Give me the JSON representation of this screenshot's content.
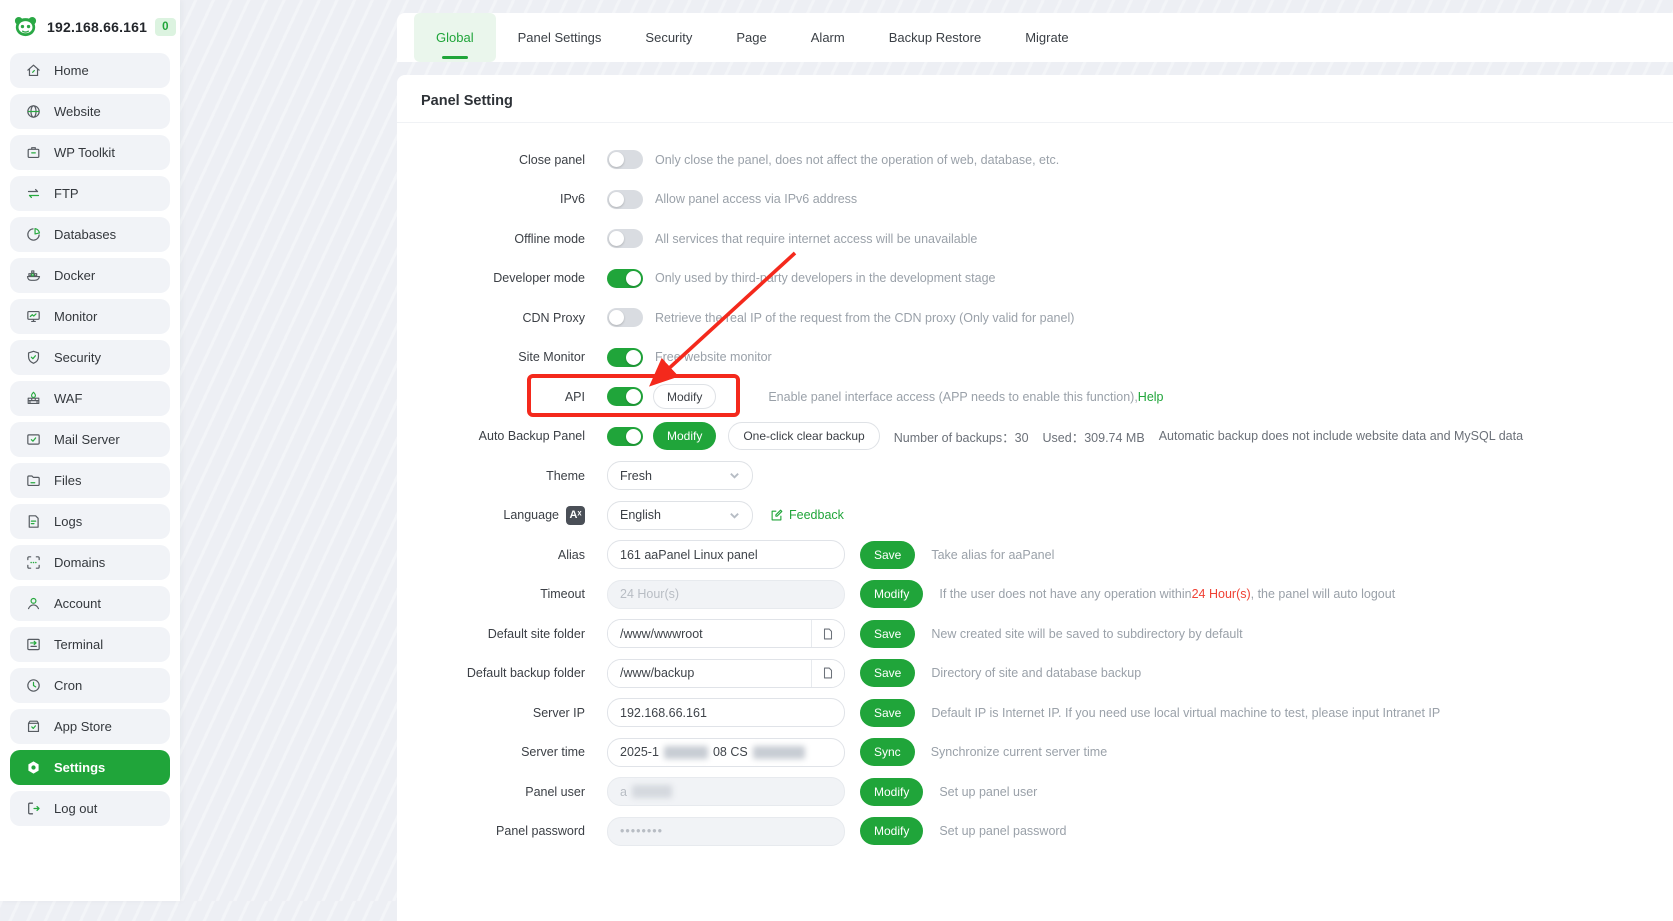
{
  "brand": {
    "ip": "192.168.66.161",
    "badge": "0"
  },
  "sidebar": {
    "items": [
      {
        "label": "Home",
        "icon": "home",
        "active": false
      },
      {
        "label": "Website",
        "icon": "website",
        "active": false
      },
      {
        "label": "WP Toolkit",
        "icon": "wp-toolkit",
        "active": false
      },
      {
        "label": "FTP",
        "icon": "ftp",
        "active": false
      },
      {
        "label": "Databases",
        "icon": "databases",
        "active": false
      },
      {
        "label": "Docker",
        "icon": "docker",
        "active": false
      },
      {
        "label": "Monitor",
        "icon": "monitor",
        "active": false
      },
      {
        "label": "Security",
        "icon": "security",
        "active": false
      },
      {
        "label": "WAF",
        "icon": "waf",
        "active": false
      },
      {
        "label": "Mail Server",
        "icon": "mail-server",
        "active": false
      },
      {
        "label": "Files",
        "icon": "files",
        "active": false
      },
      {
        "label": "Logs",
        "icon": "logs",
        "active": false
      },
      {
        "label": "Domains",
        "icon": "domains",
        "active": false
      },
      {
        "label": "Account",
        "icon": "account",
        "active": false
      },
      {
        "label": "Terminal",
        "icon": "terminal",
        "active": false
      },
      {
        "label": "Cron",
        "icon": "cron",
        "active": false
      },
      {
        "label": "App Store",
        "icon": "app-store",
        "active": false
      },
      {
        "label": "Settings",
        "icon": "settings",
        "active": true
      },
      {
        "label": "Log out",
        "icon": "logout",
        "active": false
      }
    ]
  },
  "tabs": [
    {
      "label": "Global",
      "active": true
    },
    {
      "label": "Panel Settings",
      "active": false
    },
    {
      "label": "Security",
      "active": false
    },
    {
      "label": "Page",
      "active": false
    },
    {
      "label": "Alarm",
      "active": false
    },
    {
      "label": "Backup Restore",
      "active": false
    },
    {
      "label": "Migrate",
      "active": false
    }
  ],
  "panel": {
    "title": "Panel Setting",
    "rows": {
      "close_panel": {
        "label": "Close panel",
        "desc": "Only close the panel, does not affect the operation of web, database, etc."
      },
      "ipv6": {
        "label": "IPv6",
        "desc": "Allow panel access via IPv6 address"
      },
      "offline_mode": {
        "label": "Offline mode",
        "desc": "All services that require internet access will be unavailable"
      },
      "developer_mode": {
        "label": "Developer mode",
        "desc": "Only used by third-party developers in the development stage"
      },
      "cdn_proxy": {
        "label": "CDN Proxy",
        "desc": "Retrieve the real IP of the request from the CDN proxy  (Only valid for panel)"
      },
      "site_monitor": {
        "label": "Site Monitor",
        "desc": "Free website monitor"
      },
      "api": {
        "label": "API",
        "modify": "Modify",
        "desc": "Enable panel interface access (APP needs to enable this function),",
        "help": "Help"
      },
      "auto_backup": {
        "label": "Auto Backup Panel",
        "modify": "Modify",
        "clear": "One-click clear backup",
        "count_label": "Number of backups：",
        "count": "30",
        "used_label": "Used：",
        "used": "309.74 MB",
        "warning": "Automatic backup does not include website data and MySQL data"
      },
      "theme": {
        "label": "Theme",
        "value": "Fresh"
      },
      "language": {
        "label": "Language",
        "icon_text": "Aˣ",
        "value": "English",
        "feedback": "Feedback"
      },
      "alias": {
        "label": "Alias",
        "value": "161 aaPanel Linux panel",
        "button": "Save",
        "desc": "Take alias for aaPanel"
      },
      "timeout": {
        "label": "Timeout",
        "placeholder": "24 Hour(s)",
        "button": "Modify",
        "desc_before": "If the user does not have any operation within",
        "highlight": "24 Hour(s)",
        "desc_after": ", the panel will auto logout"
      },
      "site_folder": {
        "label": "Default site folder",
        "value": "/www/wwwroot",
        "button": "Save",
        "desc": "New created site will be saved to subdirectory by default"
      },
      "backup_folder": {
        "label": "Default backup folder",
        "value": "/www/backup",
        "button": "Save",
        "desc": "Directory of site and database backup"
      },
      "server_ip": {
        "label": "Server IP",
        "value": "192.168.66.161",
        "button": "Save",
        "desc": "Default IP is Internet IP. If you need use local virtual machine to test, please input Intranet IP"
      },
      "server_time": {
        "label": "Server time",
        "value_prefix": "2025-1",
        "value_mid": "08 CS",
        "button": "Sync",
        "desc": "Synchronize current server time"
      },
      "panel_user": {
        "label": "Panel user",
        "value_prefix": "a",
        "button": "Modify",
        "desc": "Set up panel user"
      },
      "panel_password": {
        "label": "Panel password",
        "value": "••••••••",
        "button": "Modify",
        "desc": "Set up panel password"
      }
    }
  },
  "colors": {
    "accent_green": "#20a53a",
    "annotation_red": "#f4291c",
    "warning_red": "#f04134"
  }
}
